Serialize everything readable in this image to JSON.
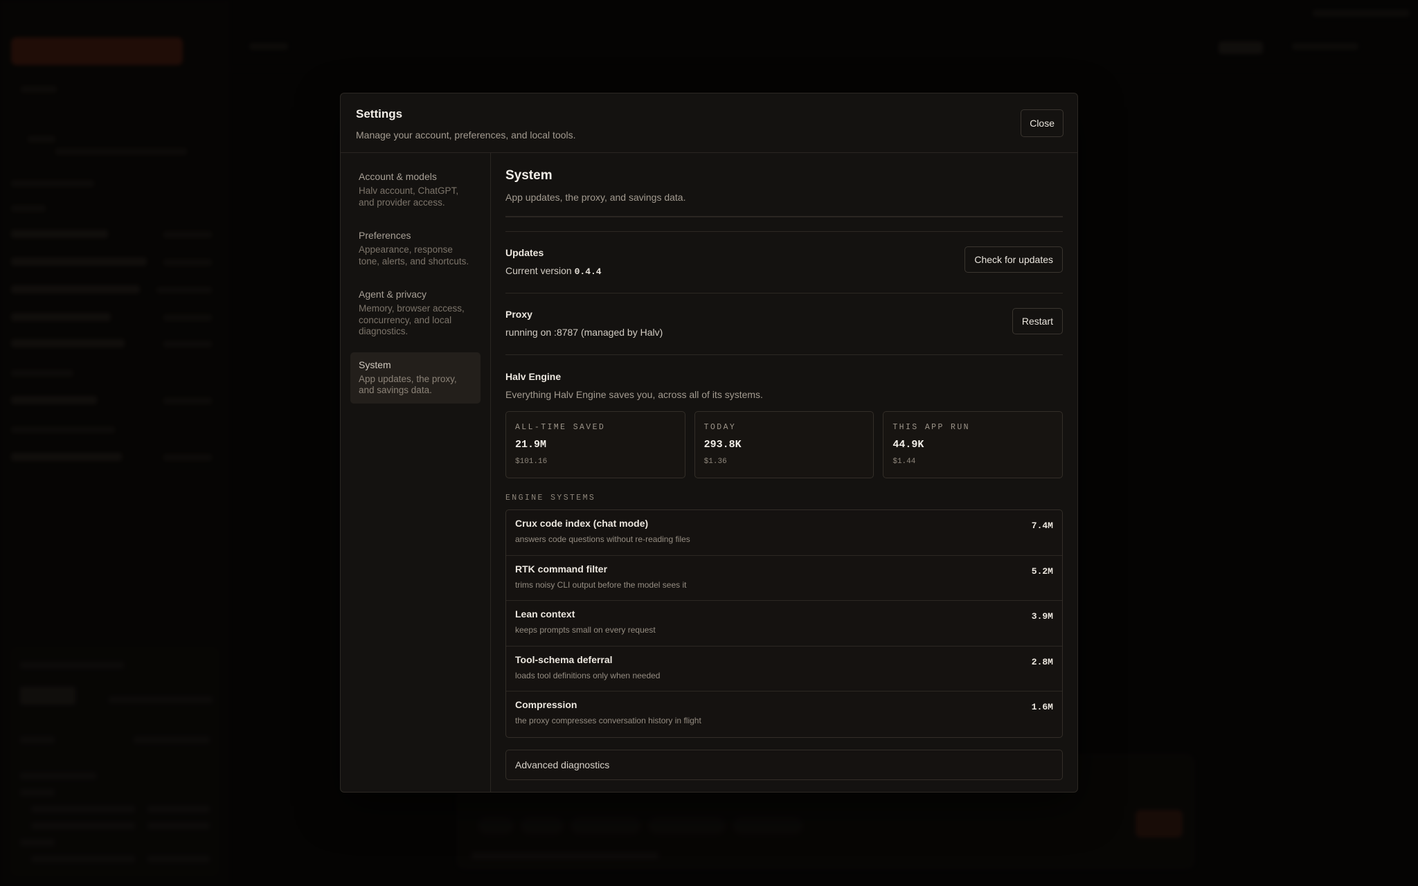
{
  "modal": {
    "title": "Settings",
    "subtitle": "Manage your account, preferences, and local tools.",
    "close_label": "Close"
  },
  "nav": {
    "items": [
      {
        "label": "Account & models",
        "description": "Halv account, ChatGPT, and provider access."
      },
      {
        "label": "Preferences",
        "description": "Appearance, response tone, alerts, and shortcuts."
      },
      {
        "label": "Agent & privacy",
        "description": "Memory, browser access, concurrency, and local diagnostics."
      },
      {
        "label": "System",
        "description": "App updates, the proxy, and savings data."
      }
    ],
    "active_index": 3
  },
  "system": {
    "title": "System",
    "subtitle": "App updates, the proxy, and savings data.",
    "updates": {
      "label": "Updates",
      "value_prefix": "Current version",
      "version": "0.4.4",
      "button_label": "Check for updates"
    },
    "proxy": {
      "label": "Proxy",
      "value": "running on :8787 (managed by Halv)",
      "button_label": "Restart"
    },
    "engine": {
      "label": "Halv Engine",
      "description": "Everything Halv Engine saves you, across all of its systems.",
      "stats": [
        {
          "label": "ALL-TIME SAVED",
          "value": "21.9M",
          "cost": "$101.16"
        },
        {
          "label": "TODAY",
          "value": "293.8K",
          "cost": "$1.36"
        },
        {
          "label": "THIS APP RUN",
          "value": "44.9K",
          "cost": "$1.44"
        }
      ],
      "systems_heading": "ENGINE SYSTEMS",
      "systems": [
        {
          "name": "Crux code index (chat mode)",
          "description": "answers code questions without re-reading files",
          "value": "7.4M"
        },
        {
          "name": "RTK command filter",
          "description": "trims noisy CLI output before the model sees it",
          "value": "5.2M"
        },
        {
          "name": "Lean context",
          "description": "keeps prompts small on every request",
          "value": "3.9M"
        },
        {
          "name": "Tool-schema deferral",
          "description": "loads tool definitions only when needed",
          "value": "2.8M"
        },
        {
          "name": "Compression",
          "description": "the proxy compresses conversation history in flight",
          "value": "1.6M"
        }
      ]
    },
    "advanced_label": "Advanced diagnostics"
  }
}
